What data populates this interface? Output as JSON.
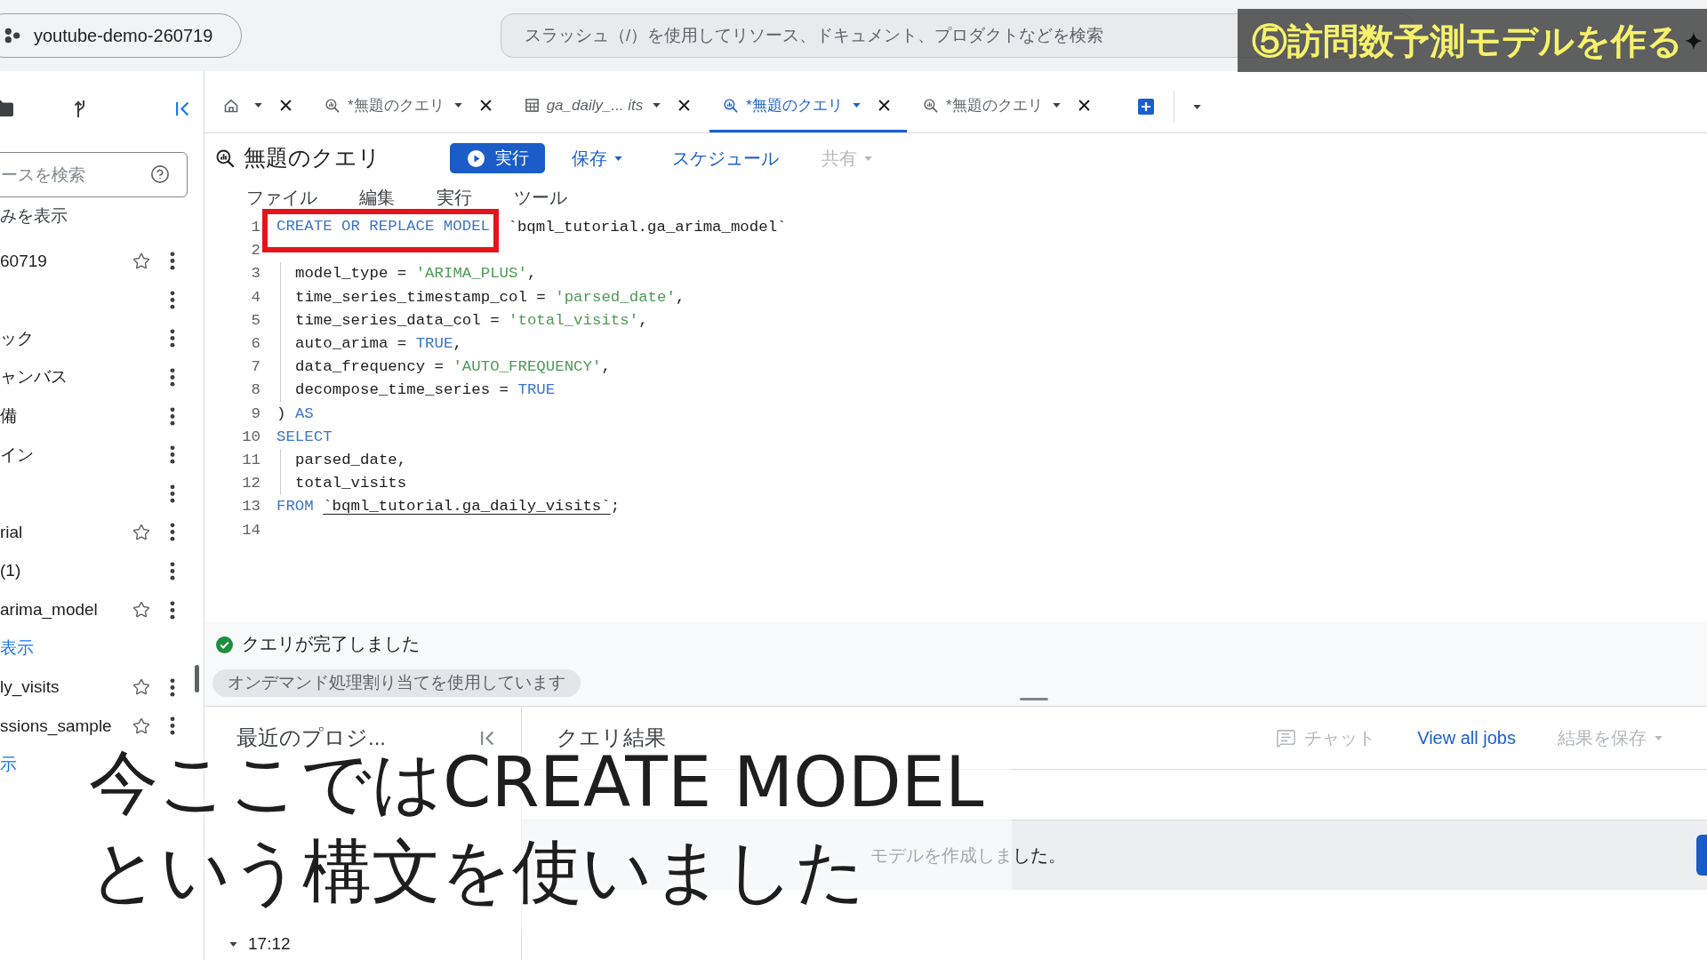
{
  "project_chip": {
    "label": "youtube-demo-260719"
  },
  "search": {
    "placeholder": "スラッシュ（/）を使用してリソース、ドキュメント、プロダクトなどを検索"
  },
  "title_banner": {
    "text": "⑤訪問数予測モデルを作る"
  },
  "sidebar": {
    "search": {
      "placeholder": "ースを検索"
    },
    "filter_link": "みを表示",
    "items": [
      {
        "kind": "resource",
        "label": "60719"
      },
      {
        "kind": "node"
      },
      {
        "kind": "node",
        "label": "ック"
      },
      {
        "kind": "node",
        "label": "ャンバス"
      },
      {
        "kind": "node",
        "label": "備"
      },
      {
        "kind": "node",
        "label": "イン"
      },
      {
        "kind": "node"
      },
      {
        "kind": "resource",
        "label": "rial"
      },
      {
        "kind": "node",
        "label": "(1)"
      },
      {
        "kind": "resource",
        "label": "arima_model"
      },
      {
        "kind": "link",
        "label": "表示"
      },
      {
        "kind": "resource",
        "label": "ly_visits"
      },
      {
        "kind": "resource",
        "label": "ssions_sample"
      },
      {
        "kind": "link",
        "label": "示"
      }
    ]
  },
  "tabs": [
    {
      "kind": "home",
      "selected": false
    },
    {
      "kind": "query",
      "label": "*無題のクエリ",
      "preview": false,
      "selected": false
    },
    {
      "kind": "table",
      "label": "ga_daily_... its",
      "preview": true,
      "selected": false
    },
    {
      "kind": "query",
      "label": "*無題のクエリ",
      "preview": false,
      "selected": true
    },
    {
      "kind": "query",
      "label": "*無題のクエリ",
      "preview": false,
      "selected": false
    }
  ],
  "query": {
    "title": "無題のクエリ",
    "run_button": "実行",
    "toolbar": [
      {
        "kind": "dropdown",
        "label": "保存",
        "disabled": false
      },
      {
        "kind": "button",
        "label": "スケジュール",
        "disabled": false
      },
      {
        "kind": "dropdown",
        "label": "共有",
        "disabled": true
      }
    ],
    "menu": [
      "ファイル",
      "編集",
      "実行",
      "ツール"
    ],
    "code_lines": [
      {
        "number": "1",
        "indented": false,
        "tokens": [
          {
            "kind": "boxed_keyword",
            "text": "CREATE OR REPLACE MODEL"
          },
          {
            "kind": "plain",
            "text": " `bqml_tutorial.ga_arima_model`"
          }
        ]
      },
      {
        "number": "2"
      },
      {
        "number": "3",
        "indented": true,
        "tokens": [
          {
            "kind": "plain",
            "text": "model_type = "
          },
          {
            "kind": "string",
            "text": "'ARIMA_PLUS'"
          },
          {
            "kind": "plain",
            "text": ","
          }
        ]
      },
      {
        "number": "4",
        "indented": true,
        "tokens": [
          {
            "kind": "plain",
            "text": "time_series_timestamp_col = "
          },
          {
            "kind": "string",
            "text": "'parsed_date'"
          },
          {
            "kind": "plain",
            "text": ","
          }
        ]
      },
      {
        "number": "5",
        "indented": true,
        "tokens": [
          {
            "kind": "plain",
            "text": "time_series_data_col = "
          },
          {
            "kind": "string",
            "text": "'total_visits'"
          },
          {
            "kind": "plain",
            "text": ","
          }
        ]
      },
      {
        "number": "6",
        "indented": true,
        "tokens": [
          {
            "kind": "plain",
            "text": "auto_arima = "
          },
          {
            "kind": "keyword",
            "text": "TRUE"
          },
          {
            "kind": "plain",
            "text": ","
          }
        ]
      },
      {
        "number": "7",
        "indented": true,
        "tokens": [
          {
            "kind": "plain",
            "text": "data_frequency = "
          },
          {
            "kind": "string",
            "text": "'AUTO_FREQUENCY'"
          },
          {
            "kind": "plain",
            "text": ","
          }
        ]
      },
      {
        "number": "8",
        "indented": true,
        "tokens": [
          {
            "kind": "plain",
            "text": "decompose_time_series = "
          },
          {
            "kind": "keyword",
            "text": "TRUE"
          }
        ]
      },
      {
        "number": "9",
        "indented": false,
        "tokens": [
          {
            "kind": "plain",
            "text": ") "
          },
          {
            "kind": "keyword",
            "text": "AS"
          }
        ]
      },
      {
        "number": "10",
        "indented": false,
        "tokens": [
          {
            "kind": "keyword",
            "text": "SELECT"
          }
        ]
      },
      {
        "number": "11",
        "indented": true,
        "tokens": [
          {
            "kind": "plain",
            "text": "parsed_date,"
          }
        ]
      },
      {
        "number": "12",
        "indented": true,
        "tokens": [
          {
            "kind": "plain",
            "text": "total_visits"
          }
        ]
      },
      {
        "number": "13",
        "indented": false,
        "tokens": [
          {
            "kind": "keyword",
            "text": "FROM "
          },
          {
            "kind": "reference",
            "text": "`bqml_tutorial.ga_daily_visits`"
          },
          {
            "kind": "plain",
            "text": ";"
          }
        ]
      },
      {
        "number": "14"
      }
    ]
  },
  "status": {
    "message": "クエリが完了しました",
    "chip": "オンデマンド処理割り当てを使用しています"
  },
  "recent_panel": {
    "title": "最近のプロジ...",
    "groups": [
      {
        "time": "17:12",
        "expanded": true
      }
    ]
  },
  "results_panel": {
    "title": "クエリ結果",
    "actions": [
      {
        "kind": "chat",
        "label": "チャット",
        "disabled": true
      },
      {
        "kind": "link",
        "label": "View all jobs",
        "disabled": false
      },
      {
        "kind": "dropdown",
        "label": "結果を保存",
        "disabled": true
      }
    ],
    "message": "モデルを作成しました。"
  },
  "caption": {
    "lines": [
      "今ここではCREATE MODEL",
      "という構文を使いました"
    ]
  }
}
